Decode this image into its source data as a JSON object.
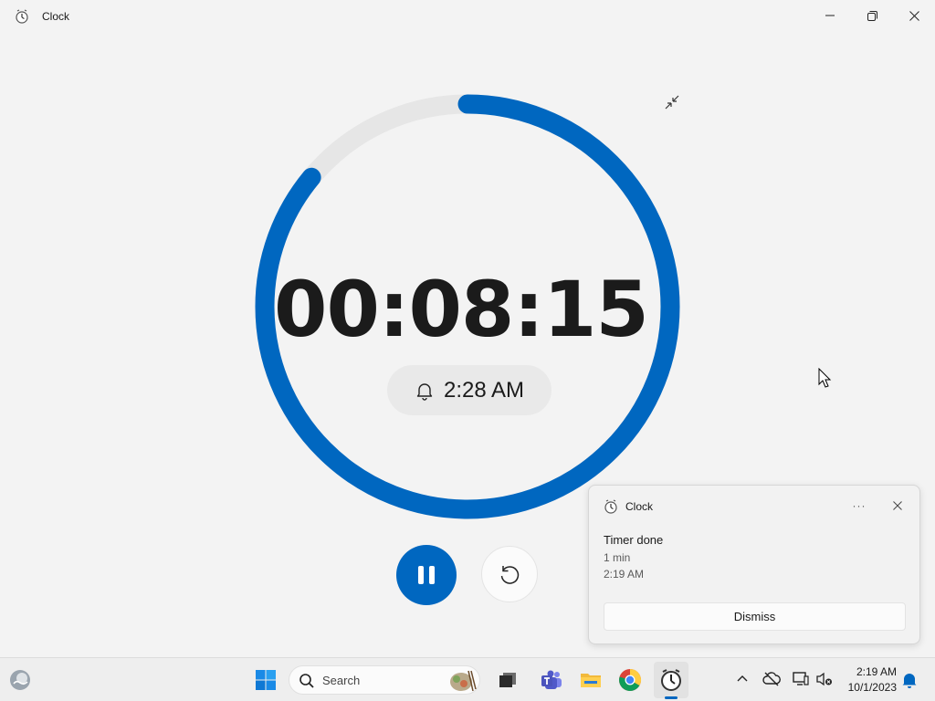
{
  "window": {
    "title": "Clock",
    "icons": {
      "app": "clock-app-icon",
      "minimize": "minimize-icon",
      "maximize": "restore-icon",
      "close": "close-icon"
    }
  },
  "timer": {
    "display": "00:08:15",
    "alarm_time": "2:28 AM",
    "progress_remaining": 0.86,
    "accent_color": "#0067c0",
    "track_color": "#e6e6e6",
    "icons": {
      "compact": "compact-overlay-icon",
      "bell": "bell-icon",
      "pause": "pause-icon",
      "reset": "reset-icon"
    }
  },
  "notification": {
    "app_name": "Clock",
    "title": "Timer done",
    "line1": "1 min",
    "line2": "2:19 AM",
    "dismiss_label": "Dismiss",
    "more_label": "···",
    "icons": {
      "app": "clock-app-icon",
      "close": "close-icon"
    }
  },
  "taskbar": {
    "search_placeholder": "Search",
    "pinned": [
      "weather-icon",
      "windows-start-icon",
      "search-icon",
      "task-view-icon",
      "teams-icon",
      "file-explorer-icon",
      "chrome-icon",
      "clock-app-icon"
    ],
    "tray": {
      "time": "2:19 AM",
      "date": "10/1/2023",
      "icons": [
        "chevron-up-icon",
        "network-icon",
        "display-icon",
        "volume-icon",
        "notification-bell-icon"
      ]
    }
  }
}
